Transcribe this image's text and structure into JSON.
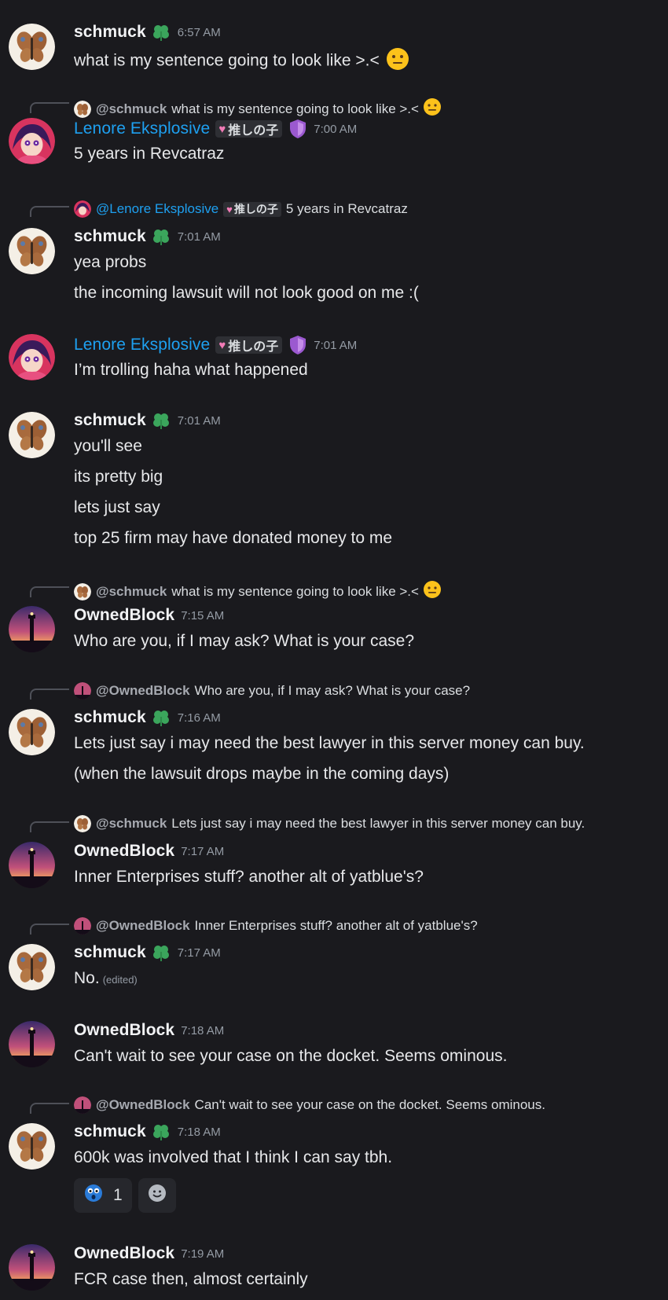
{
  "users": {
    "schmuck": "schmuck",
    "lenore": "Lenore Eksplosive",
    "owned": "OwnedBlock"
  },
  "tags": {
    "lenore_tag": "推しの子"
  },
  "colors": {
    "background": "#1a1a1e",
    "lenore_name": "#1ea0f0",
    "timestamp": "#949ba4",
    "clover": "#3ba55c",
    "shield": "#9b59d0"
  },
  "messages": [
    {
      "author": "schmuck",
      "time": "6:57 AM",
      "lines": [
        "what is my sentence going to look like >.<"
      ]
    },
    {
      "author": "Lenore Eksplosive",
      "time": "7:00 AM",
      "reply": {
        "name": "@schmuck",
        "text": "what is my sentence going to look like >.<"
      },
      "lines": [
        "5 years in Revcatraz"
      ]
    },
    {
      "author": "schmuck",
      "time": "7:01 AM",
      "reply": {
        "name": "@Lenore Eksplosive",
        "text": "5 years in Revcatraz"
      },
      "lines": [
        "yea probs",
        "the incoming lawsuit will not look good on me :("
      ]
    },
    {
      "author": "Lenore Eksplosive",
      "time": "7:01 AM",
      "lines": [
        "I’m trolling haha what happened"
      ]
    },
    {
      "author": "schmuck",
      "time": "7:01 AM",
      "lines": [
        "you'll see",
        "its pretty big",
        "lets just say",
        "top 25 firm may have donated money to me"
      ]
    },
    {
      "author": "OwnedBlock",
      "time": "7:15 AM",
      "reply": {
        "name": "@schmuck",
        "text": "what is my sentence going to look like >.<"
      },
      "lines": [
        "Who are you, if I may ask? What is your case?"
      ]
    },
    {
      "author": "schmuck",
      "time": "7:16 AM",
      "reply": {
        "name": "@OwnedBlock",
        "text": "Who are you, if I may ask? What is your case?"
      },
      "lines": [
        "Lets just say i may need the best lawyer in this server money can buy.",
        "(when the lawsuit drops maybe in the coming days)"
      ]
    },
    {
      "author": "OwnedBlock",
      "time": "7:17 AM",
      "reply": {
        "name": "@schmuck",
        "text": "Lets just say i may need the best lawyer in this server money can buy."
      },
      "lines": [
        "Inner Enterprises stuff? another alt of yatblue's?"
      ]
    },
    {
      "author": "schmuck",
      "time": "7:17 AM",
      "reply": {
        "name": "@OwnedBlock",
        "text": "Inner Enterprises stuff? another alt of yatblue's?"
      },
      "lines": [
        "No."
      ],
      "edited": "(edited)"
    },
    {
      "author": "OwnedBlock",
      "time": "7:18 AM",
      "lines": [
        "Can't wait to see your case on the docket. Seems ominous."
      ]
    },
    {
      "author": "schmuck",
      "time": "7:18 AM",
      "reply": {
        "name": "@OwnedBlock",
        "text": "Can't wait to see your case on the docket. Seems ominous."
      },
      "lines": [
        "600k was involved that I think I can say tbh."
      ],
      "reaction": {
        "icon": "blue-shocked-face-icon",
        "count": "1"
      }
    },
    {
      "author": "OwnedBlock",
      "time": "7:19 AM",
      "lines": [
        "FCR case then, almost certainly"
      ]
    }
  ]
}
